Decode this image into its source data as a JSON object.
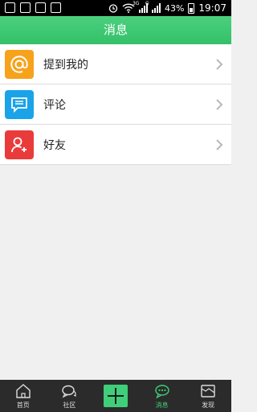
{
  "status_bar": {
    "battery": "43%",
    "time": "19:07",
    "network_label": "3G",
    "signal2_label": "G"
  },
  "header": {
    "title": "消息"
  },
  "menu": {
    "items": [
      {
        "label": "提到我的",
        "icon": "at-icon",
        "color": "#f7a21b"
      },
      {
        "label": "评论",
        "icon": "comment-icon",
        "color": "#1aa3e8"
      },
      {
        "label": "好友",
        "icon": "add-friend-icon",
        "color": "#ea3b3b"
      }
    ]
  },
  "bottom_nav": {
    "items": [
      {
        "label": "首页",
        "icon": "home-icon"
      },
      {
        "label": "社区",
        "icon": "community-icon"
      },
      {
        "label": "",
        "icon": "plus-icon"
      },
      {
        "label": "消息",
        "icon": "message-icon",
        "active": true
      },
      {
        "label": "发现",
        "icon": "discover-icon"
      }
    ]
  },
  "colors": {
    "accent": "#3fcf7a",
    "title_bar": "#3ac570",
    "nav_bg": "#2b2b2b"
  }
}
